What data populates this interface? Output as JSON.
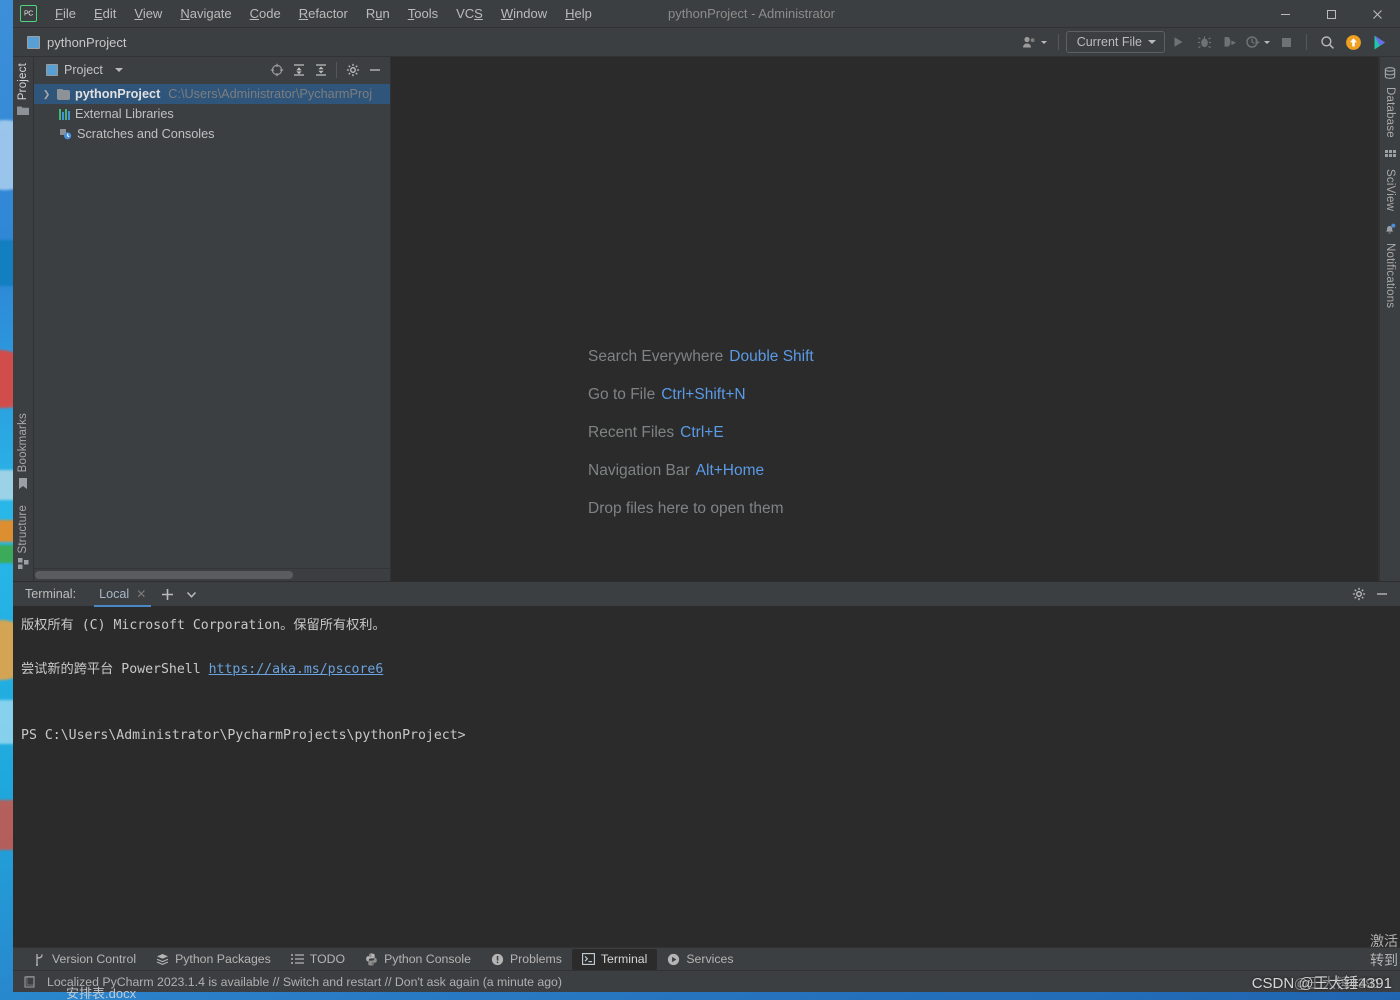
{
  "window": {
    "title": "pythonProject - Administrator",
    "controls": {
      "minimize": "minimize-button",
      "maximize": "maximize-button",
      "close": "close-button"
    }
  },
  "menu": {
    "items": [
      {
        "label": "File",
        "mnemonic": "F"
      },
      {
        "label": "Edit",
        "mnemonic": "E"
      },
      {
        "label": "View",
        "mnemonic": "V"
      },
      {
        "label": "Navigate",
        "mnemonic": "N"
      },
      {
        "label": "Code",
        "mnemonic": "C"
      },
      {
        "label": "Refactor",
        "mnemonic": "R"
      },
      {
        "label": "Run",
        "mnemonic": "u"
      },
      {
        "label": "Tools",
        "mnemonic": "T"
      },
      {
        "label": "VCS",
        "mnemonic": "S"
      },
      {
        "label": "Window",
        "mnemonic": "W"
      },
      {
        "label": "Help",
        "mnemonic": "H"
      }
    ]
  },
  "toolbar": {
    "breadcrumb": "pythonProject",
    "run_configuration": "Current File",
    "buttons": [
      "profile-icon",
      "run-button",
      "debug-button",
      "run-coverage-button",
      "profiler-button",
      "stop-button",
      "search-everywhere-button",
      "updates-icon",
      "ide-feature-icon"
    ]
  },
  "left_toolbar": {
    "top": [
      {
        "label": "Project",
        "icon": "folder-icon",
        "active": true
      }
    ],
    "bottom": [
      {
        "label": "Bookmarks",
        "icon": "bookmark-icon"
      },
      {
        "label": "Structure",
        "icon": "structure-icon"
      }
    ]
  },
  "right_toolbar": {
    "items": [
      {
        "label": "Database",
        "icon": "database-icon"
      },
      {
        "label": "SciView",
        "icon": "sciview-icon"
      },
      {
        "label": "Notifications",
        "icon": "notifications-icon"
      }
    ]
  },
  "project_panel": {
    "title": "Project",
    "actions": [
      "select-opened-file-icon",
      "expand-all-icon",
      "collapse-all-icon",
      "settings-icon",
      "hide-icon"
    ],
    "tree": [
      {
        "name": "pythonProject",
        "path": "C:\\Users\\Administrator\\PycharmProj",
        "icon": "folder-icon",
        "expandable": true,
        "selected": true,
        "indent": 0
      },
      {
        "name": "External Libraries",
        "path": "",
        "icon": "library-icon",
        "expandable": false,
        "selected": false,
        "indent": 1
      },
      {
        "name": "Scratches and Consoles",
        "path": "",
        "icon": "scratches-icon",
        "expandable": false,
        "selected": false,
        "indent": 1
      }
    ]
  },
  "editor": {
    "hints": [
      {
        "action": "Search Everywhere",
        "shortcut": "Double Shift"
      },
      {
        "action": "Go to File",
        "shortcut": "Ctrl+Shift+N"
      },
      {
        "action": "Recent Files",
        "shortcut": "Ctrl+E"
      },
      {
        "action": "Navigation Bar",
        "shortcut": "Alt+Home"
      },
      {
        "action": "Drop files here to open them",
        "shortcut": ""
      }
    ]
  },
  "terminal": {
    "label": "Terminal:",
    "tabs": [
      {
        "name": "Local",
        "active": true,
        "closable": true
      }
    ],
    "add_label": "+",
    "actions": [
      "settings-icon",
      "hide-icon"
    ],
    "lines": [
      {
        "text": "版权所有 (C) Microsoft Corporation。保留所有权利。",
        "type": "text"
      },
      {
        "text": "",
        "type": "blank"
      },
      {
        "text": "尝试新的跨平台 PowerShell ",
        "type": "text",
        "link": "https://aka.ms/pscore6"
      },
      {
        "text": "",
        "type": "blank"
      },
      {
        "text": "",
        "type": "blank"
      },
      {
        "text": "PS C:\\Users\\Administrator\\PycharmProjects\\pythonProject>",
        "type": "prompt"
      }
    ]
  },
  "bottom_bar": {
    "items": [
      {
        "label": "Version Control",
        "icon": "branch-icon",
        "active": false
      },
      {
        "label": "Python Packages",
        "icon": "packages-icon",
        "active": false
      },
      {
        "label": "TODO",
        "icon": "todo-icon",
        "active": false
      },
      {
        "label": "Python Console",
        "icon": "python-icon",
        "active": false
      },
      {
        "label": "Problems",
        "icon": "problems-icon",
        "active": false
      },
      {
        "label": "Terminal",
        "icon": "terminal-icon",
        "active": true
      },
      {
        "label": "Services",
        "icon": "services-icon",
        "active": false
      }
    ]
  },
  "status_bar": {
    "icon": "memory-icon",
    "message": "Localized PyCharm 2023.1.4 is available // Switch and restart // Don't ask again (a minute ago)"
  },
  "watermarks": {
    "csdn": "CSDN @王大锤4391",
    "csdn_ghost": "@王大锤4391",
    "activation_line1": "激活",
    "activation_line2": "转到",
    "taskbar_doc": "安排表.docx"
  },
  "colors": {
    "background": "#3c3f41",
    "editor_background": "#2b2b2b",
    "accent_blue": "#5a9ae6",
    "selection": "#2f557b",
    "tab_underline": "#4a88c7",
    "desktop": "#29b7e8"
  }
}
